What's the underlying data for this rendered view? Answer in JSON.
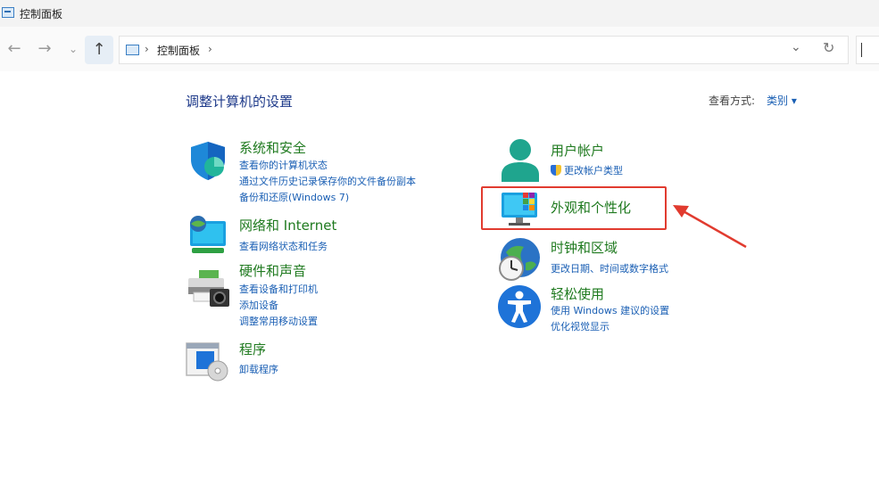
{
  "window": {
    "title": "控制面板"
  },
  "nav": {
    "back_icon": "arrow-left-icon",
    "forward_icon": "arrow-right-icon",
    "recent_icon": "chevron-down-icon",
    "up_icon": "arrow-up-icon"
  },
  "address": {
    "path": "控制面板",
    "sep1": "›",
    "sep2": "›"
  },
  "page": {
    "heading": "调整计算机的设置",
    "view_by_label": "查看方式:",
    "view_by_value": "类别 ▾"
  },
  "categories": {
    "system": {
      "title": "系统和安全",
      "links": [
        "查看你的计算机状态",
        "通过文件历史记录保存你的文件备份副本",
        "备份和还原(Windows 7)"
      ]
    },
    "network": {
      "title": "网络和 Internet",
      "links": [
        "查看网络状态和任务"
      ]
    },
    "hardware": {
      "title": "硬件和声音",
      "links": [
        "查看设备和打印机",
        "添加设备",
        "调整常用移动设置"
      ]
    },
    "programs": {
      "title": "程序",
      "links": [
        "卸载程序"
      ]
    },
    "user": {
      "title": "用户帐户",
      "links": [
        "更改帐户类型"
      ]
    },
    "appearance": {
      "title": "外观和个性化",
      "links": []
    },
    "clock": {
      "title": "时钟和区域",
      "links": [
        "更改日期、时间或数字格式"
      ]
    },
    "ease": {
      "title": "轻松使用",
      "links": [
        "使用 Windows 建议的设置",
        "优化视觉显示"
      ]
    }
  },
  "colors": {
    "category_title": "#1f7a1f",
    "link": "#1a5fb4",
    "heading": "#1e3a8a",
    "annotation": "#e13b2f"
  }
}
